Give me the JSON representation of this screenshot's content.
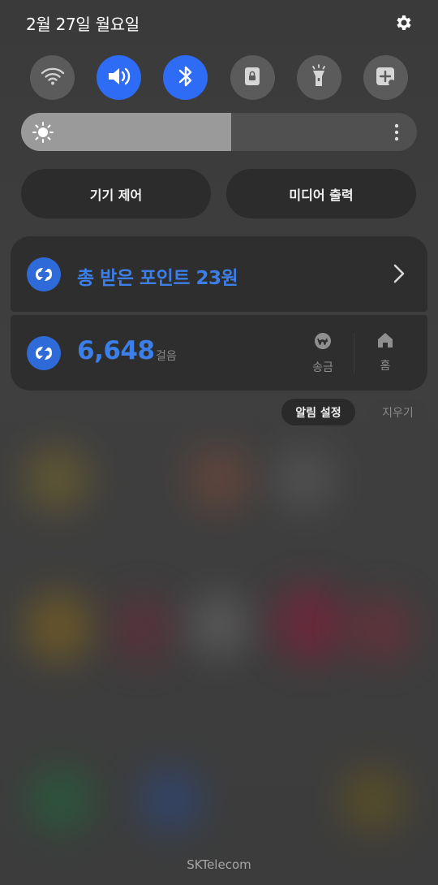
{
  "header": {
    "date": "2월 27일 월요일",
    "settings_icon": "gear-icon"
  },
  "quick_settings": [
    {
      "name": "wifi",
      "icon": "wifi-icon",
      "active": false
    },
    {
      "name": "sound",
      "icon": "volume-icon",
      "active": true
    },
    {
      "name": "bluetooth",
      "icon": "bluetooth-icon",
      "active": true
    },
    {
      "name": "rotation-lock",
      "icon": "lock-icon",
      "active": false
    },
    {
      "name": "flashlight",
      "icon": "flashlight-icon",
      "active": false
    },
    {
      "name": "add-tile",
      "icon": "add-icon",
      "active": false
    }
  ],
  "brightness": {
    "level_percent": 53
  },
  "pills": {
    "device_control": "기기 제어",
    "media_output": "미디어 출력"
  },
  "notification": {
    "points_text": "총 받은 포인트 23원",
    "steps_value": "6,648",
    "steps_unit": "걸음",
    "actions": {
      "send": "송금",
      "home": "홈"
    }
  },
  "chips": {
    "settings": "알림 설정",
    "clear": "지우기"
  },
  "carrier": "SKTelecom",
  "colors": {
    "accent": "#2f6cf5",
    "text_blue": "#3c7fe8",
    "card": "#2e2e2e"
  }
}
